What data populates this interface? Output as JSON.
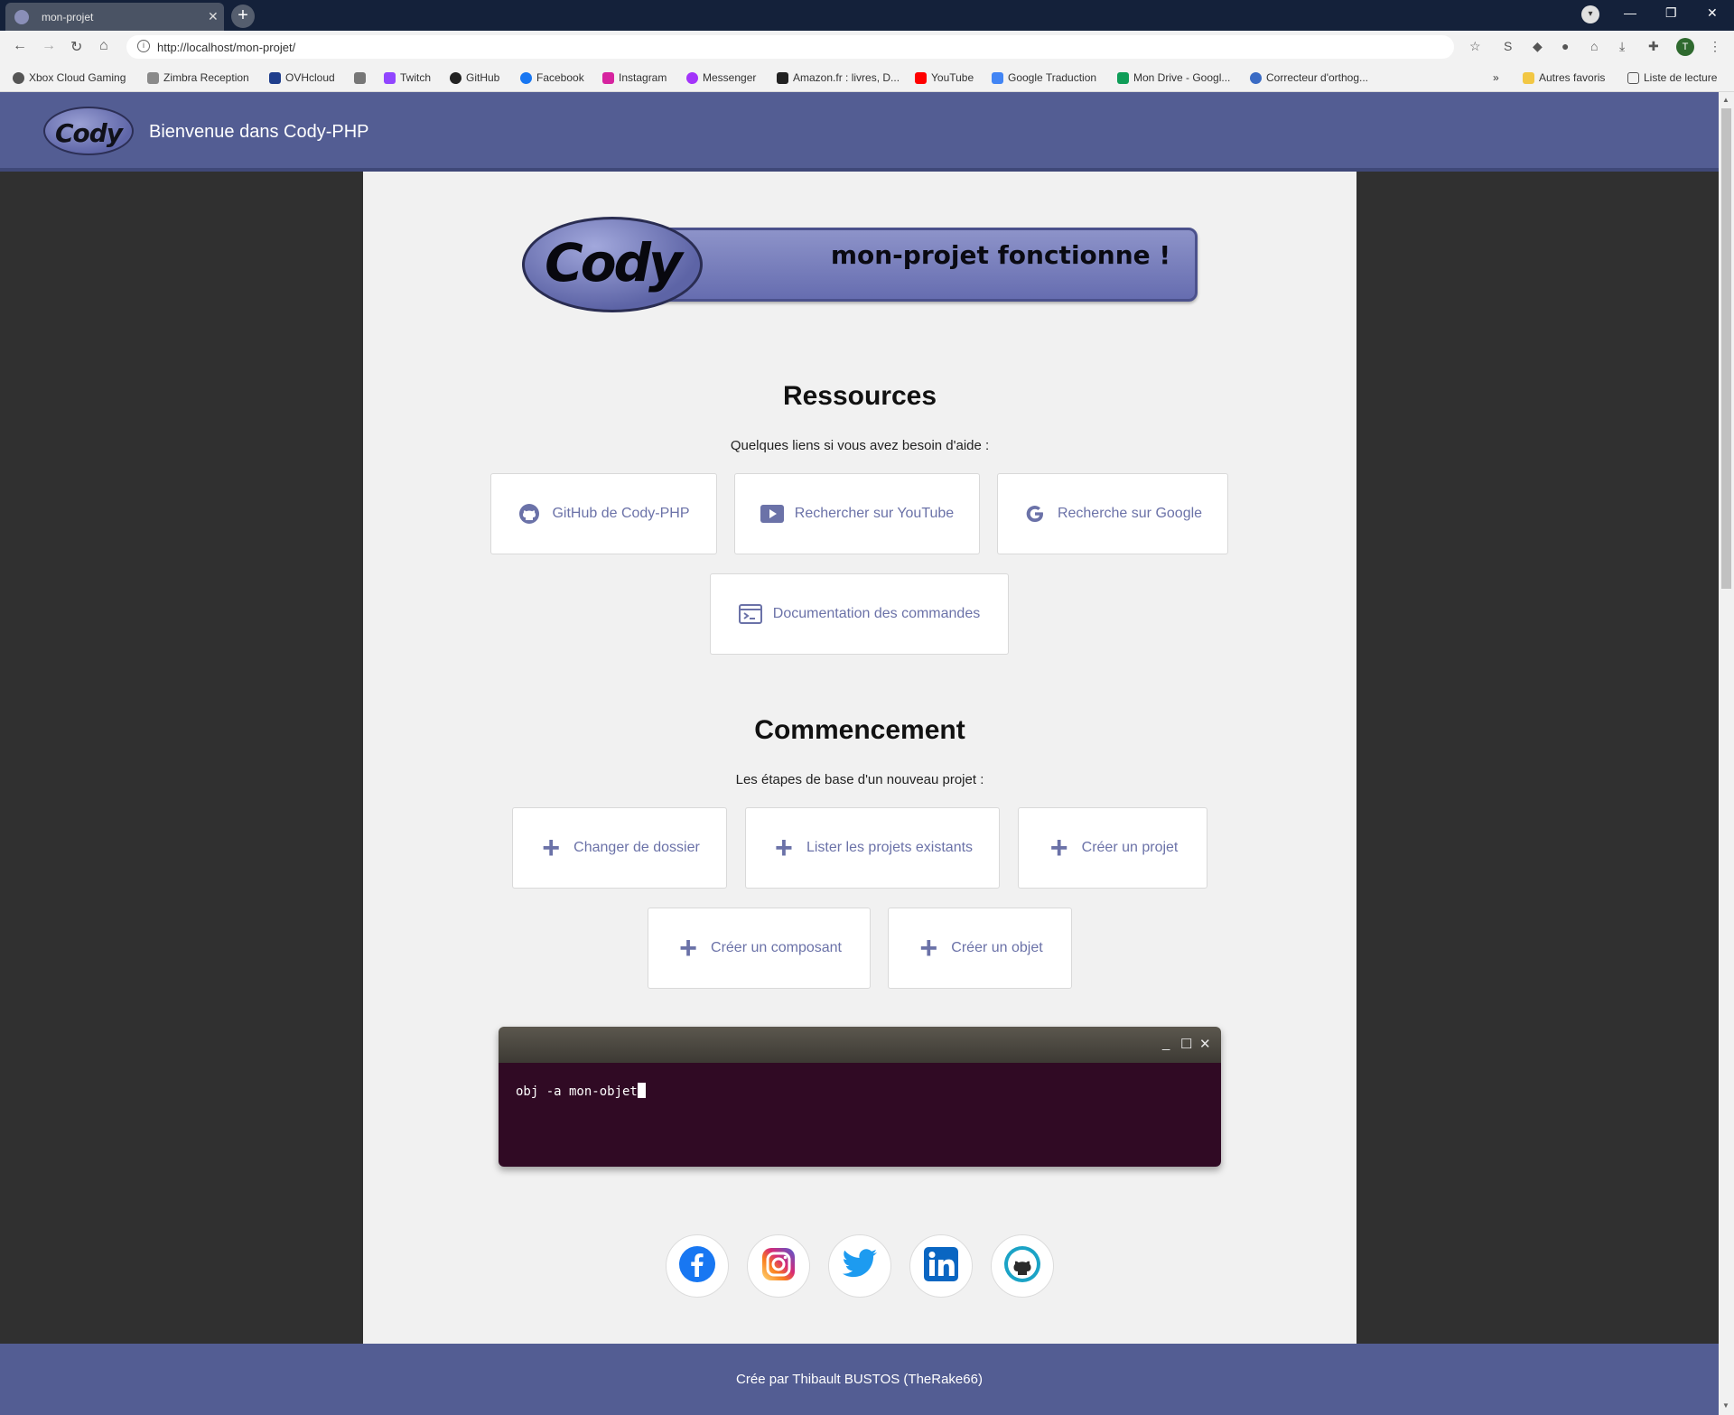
{
  "browser": {
    "tab_title": "mon-projet",
    "url": "http://localhost/mon-projet/",
    "profile_initial": "T",
    "bookmarks": [
      {
        "label": "Xbox Cloud Gaming",
        "color": "#555555"
      },
      {
        "label": "Zimbra Reception",
        "color": "#8a8a8a"
      },
      {
        "label": "OVHcloud",
        "color": "#1f3e8c"
      },
      {
        "label": "",
        "color": "#777777"
      },
      {
        "label": "Twitch",
        "color": "#9146ff"
      },
      {
        "label": "GitHub",
        "color": "#222222"
      },
      {
        "label": "Facebook",
        "color": "#1877f2"
      },
      {
        "label": "Instagram",
        "color": "#d6249f"
      },
      {
        "label": "Messenger",
        "color": "#a334fa"
      },
      {
        "label": "Amazon.fr : livres, D...",
        "color": "#222222"
      },
      {
        "label": "YouTube",
        "color": "#ff0000"
      },
      {
        "label": "Google Traduction",
        "color": "#4285f4"
      },
      {
        "label": "Mon Drive - Googl...",
        "color": "#0f9d58"
      },
      {
        "label": "Correcteur d'orthog...",
        "color": "#3a6bc4"
      }
    ],
    "bookmarks_overflow": "»",
    "other_bookmarks": "Autres favoris",
    "reading_list": "Liste de lecture"
  },
  "header": {
    "logo_text": "Cody",
    "title": "Bienvenue dans Cody-PHP"
  },
  "banner": {
    "logo_text": "Cody",
    "message": "mon-projet fonctionne !"
  },
  "resources": {
    "title": "Ressources",
    "subtitle": "Quelques liens si vous avez besoin d'aide :",
    "links": [
      {
        "label": "GitHub de Cody-PHP",
        "icon": "github-icon"
      },
      {
        "label": "Rechercher sur YouTube",
        "icon": "youtube-icon"
      },
      {
        "label": "Recherche sur Google",
        "icon": "google-icon"
      },
      {
        "label": "Documentation des commandes",
        "icon": "terminal-icon"
      }
    ]
  },
  "start": {
    "title": "Commencement",
    "subtitle": "Les étapes de base d'un nouveau projet :",
    "steps": [
      {
        "label": "Changer de dossier"
      },
      {
        "label": "Lister les projets existants"
      },
      {
        "label": "Créer un projet"
      },
      {
        "label": "Créer un composant"
      },
      {
        "label": "Créer un objet"
      }
    ]
  },
  "terminal": {
    "command": "obj -a mon-objet"
  },
  "social": [
    "facebook-icon",
    "instagram-icon",
    "twitter-icon",
    "linkedin-icon",
    "github-icon"
  ],
  "colors": {
    "brand": "#535d93",
    "link": "#6b72a8",
    "terminal_bg": "#300a24"
  },
  "footer": {
    "text": "Crée par Thibault BUSTOS (TheRake66)"
  }
}
